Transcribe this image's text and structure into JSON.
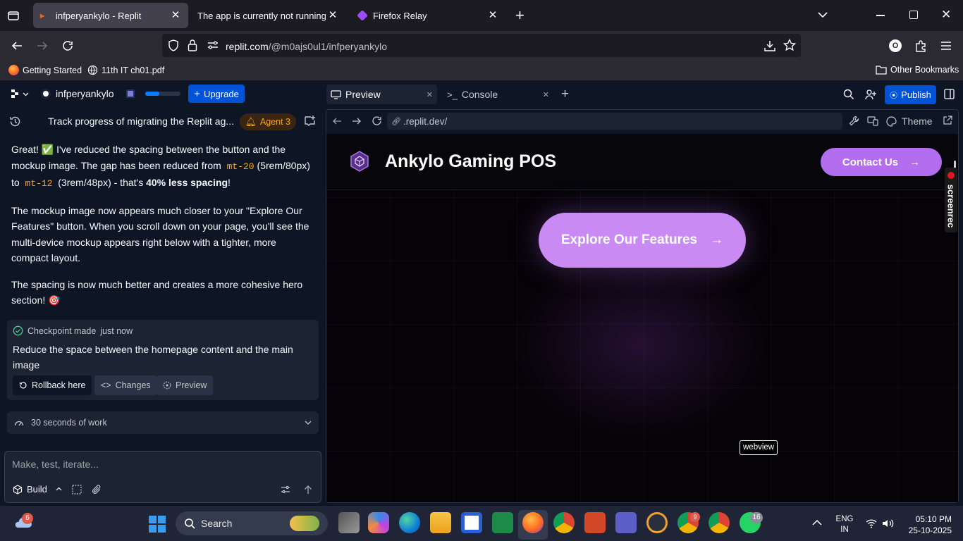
{
  "browser": {
    "tabs": [
      {
        "title": "infperyankylo - Replit",
        "active": true
      },
      {
        "title": "The app is currently not running. De",
        "active": false
      },
      {
        "title": "Firefox Relay",
        "active": false
      }
    ],
    "url_host": "replit.com",
    "url_path": "/@m0ajs0ul1/infperyankylo",
    "profile_initial": "O",
    "bookmarks": [
      "Getting Started",
      "11th IT ch01.pdf"
    ],
    "other_bookmarks": "Other Bookmarks"
  },
  "replit": {
    "project_name": "infperyankylo",
    "upgrade_label": "Upgrade",
    "thread_title": "Track progress of migrating the Replit ag...",
    "agent_badge": "Agent 3",
    "message": {
      "p1_a": "Great! ✅ I've reduced the spacing between the button and the mockup image. The gap has been reduced from",
      "code1": "mt-20",
      "p1_b": "(5rem/80px) to",
      "code2": "mt-12",
      "p1_c": "(3rem/48px) - that's",
      "p1_bold": "40% less spacing",
      "p1_d": "!",
      "p2": "The mockup image now appears much closer to your \"Explore Our Features\" button. When you scroll down on your page, you'll see the multi-device mockup appears right below with a tighter, more compact layout.",
      "p3": "The spacing is now much better and creates a more cohesive hero section! 🎯"
    },
    "checkpoint": {
      "label": "Checkpoint made",
      "time": "just now",
      "description": "Reduce the space between the homepage content and the main image",
      "rollback": "Rollback here",
      "changes": "Changes",
      "preview": "Preview"
    },
    "work_summary": "30 seconds of work",
    "input_placeholder": "Make, test, iterate...",
    "build_label": "Build",
    "panel_tabs": [
      {
        "label": "Preview",
        "active": true
      },
      {
        "label": "Console",
        "active": false
      }
    ],
    "publish_label": "Publish",
    "preview_url": ".replit.dev/",
    "theme_label": "Theme"
  },
  "site": {
    "brand": "Ankylo Gaming POS",
    "contact": "Contact Us",
    "cta": "Explore Our Features",
    "tooltip": "webview",
    "screenrec": "screenrec"
  },
  "taskbar": {
    "weather_badge": "6",
    "search_label": "Search",
    "lang_top": "ENG",
    "lang_bottom": "IN",
    "time": "05:10 PM",
    "date": "25-10-2025",
    "chrome_badge": "9",
    "whatsapp_badge": "16"
  },
  "colors": {
    "accent_purple": "#c98bf3",
    "replit_blue": "#0053d6",
    "agent_orange": "#f5a623"
  }
}
